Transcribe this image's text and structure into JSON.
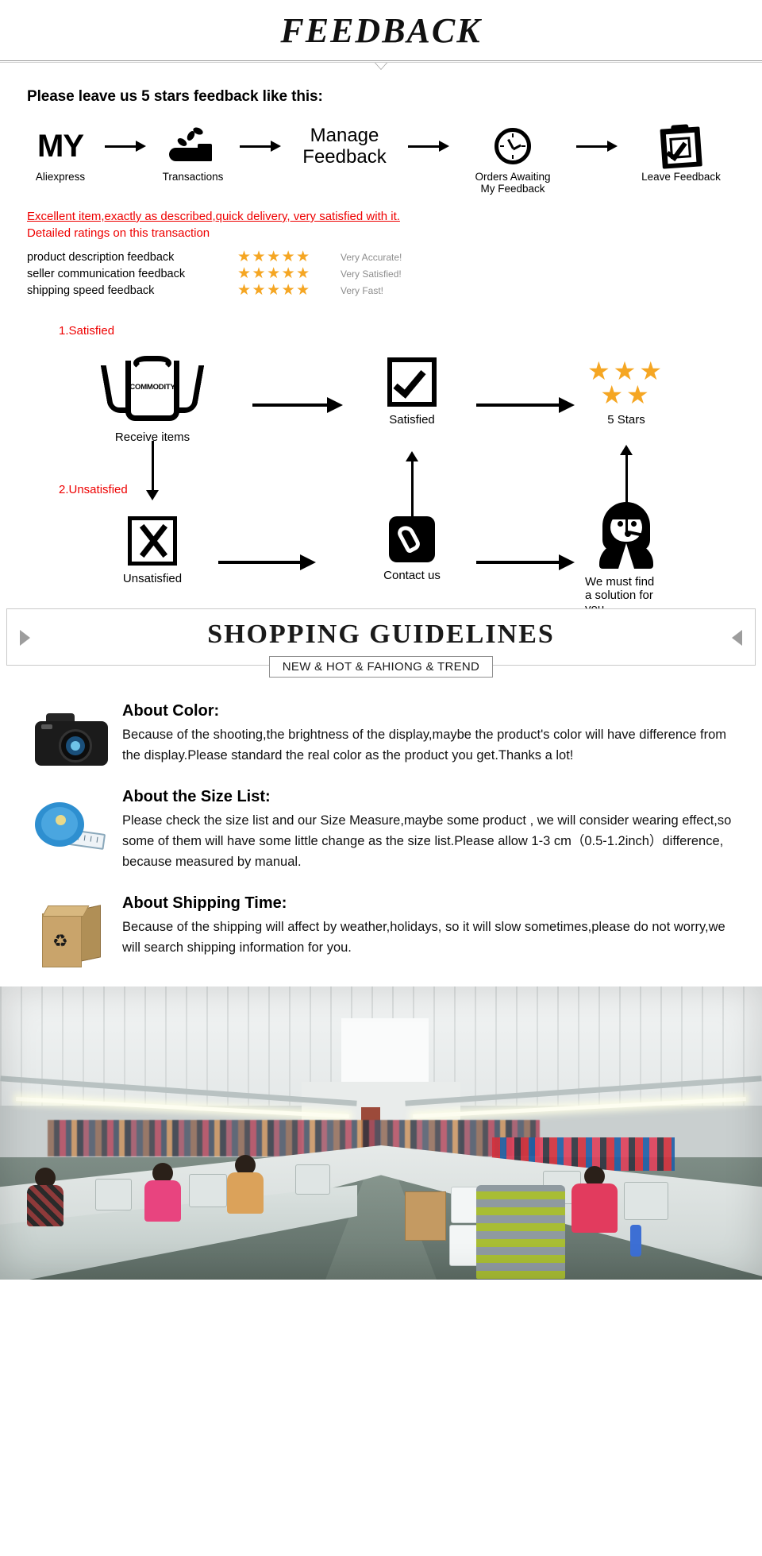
{
  "header": {
    "title": "FEEDBACK"
  },
  "feedback_section": {
    "heading": "Please leave us 5 stars feedback like this:",
    "steps": [
      {
        "icon": "my-aliexpress-logo",
        "word": "MY",
        "label": "Aliexpress"
      },
      {
        "icon": "coins-in-hand-icon",
        "word": "",
        "label": "Transactions"
      },
      {
        "icon": "manage-feedback-text",
        "word": "Manage\nFeedback",
        "label": ""
      },
      {
        "icon": "clock-icon",
        "word": "",
        "label": "Orders Awaiting\nMy Feedback"
      },
      {
        "icon": "clipboard-check-icon",
        "word": "",
        "label": "Leave Feedback"
      }
    ],
    "review_comment": "Excellent item,exactly as described,quick delivery, very satisfied with it.",
    "ratings_title": "Detailed ratings on this transaction",
    "ratings": [
      {
        "name": "product description feedback",
        "stars": "★★★★★",
        "desc": "Very Accurate!"
      },
      {
        "name": "seller communication feedback",
        "stars": "★★★★★",
        "desc": "Very Satisfied!"
      },
      {
        "name": "shipping speed feedback",
        "stars": "★★★★★",
        "desc": "Very Fast!"
      }
    ],
    "colors": {
      "red": "#ee0000",
      "star": "#F5A623",
      "desc_gray": "#8d8d8d"
    }
  },
  "flowchart": {
    "branch_satisfied": "1.Satisfied",
    "branch_unsatisfied": "2.Unsatisfied",
    "nodes": {
      "receive_items": {
        "caption": "Receive items",
        "badge": "COMMODITY"
      },
      "satisfied": {
        "caption": "Satisfied"
      },
      "five_stars": {
        "caption": "5 Stars",
        "row1": "★★★",
        "row2": "★★"
      },
      "unsatisfied": {
        "caption": "Unsatisfied"
      },
      "contact_us": {
        "caption": "Contact us"
      },
      "solution": {
        "caption": "We must find\na solution for\nyou."
      }
    }
  },
  "guidelines_banner": {
    "title": "SHOPPING GUIDELINES",
    "subtitle": "NEW & HOT & FAHIONG & TREND"
  },
  "guidelines": [
    {
      "icon": "camera-icon",
      "heading": "About Color:",
      "body": "Because of the shooting,the brightness of the display,maybe the product's color will have difference from the display.Please standard the real color as the product you get.Thanks a lot!"
    },
    {
      "icon": "tape-measure-icon",
      "heading": "About the Size List:",
      "body": "Please check the size list and our Size Measure,maybe some product , we will consider wearing effect,so some of them will have some little change as the size list.Please allow 1-3 cm（0.5-1.2inch）difference, because measured by manual."
    },
    {
      "icon": "shipping-box-icon",
      "heading": "About Shipping Time:",
      "body": "Because of the shipping will affect by weather,holidays, so it will slow sometimes,please do not worry,we will search shipping information for you."
    }
  ],
  "factory_photo": {
    "alt": "garment factory sewing floor with workers at sewing machines"
  }
}
